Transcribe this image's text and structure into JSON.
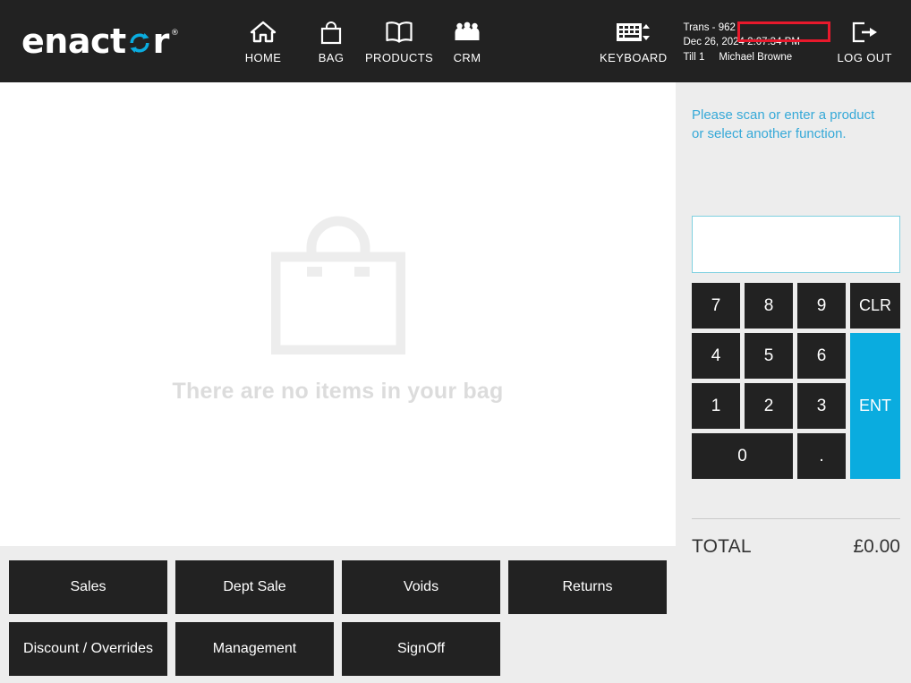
{
  "brand": {
    "name": "enactor",
    "trademark": "®",
    "accent_color": "#0aacdf"
  },
  "header": {
    "nav": [
      {
        "label": "HOME",
        "icon": "home-icon"
      },
      {
        "label": "BAG",
        "icon": "shopping-bag-icon"
      },
      {
        "label": "PRODUCTS",
        "icon": "book-icon"
      },
      {
        "label": "CRM",
        "icon": "people-icon"
      }
    ],
    "keyboard": {
      "label": "KEYBOARD",
      "icon": "keyboard-icon"
    },
    "transaction": {
      "trans": "Trans - 962",
      "datetime": "Dec 26, 2024 2:07:34 PM",
      "till": "Till 1",
      "user": "Michael Browne",
      "highlight_color": "#e8192c"
    },
    "logout": {
      "label": "LOG OUT",
      "icon": "logout-icon"
    }
  },
  "bag": {
    "icon": "shopping-bag-outline-icon",
    "empty_message": "There are no items in your bag"
  },
  "functions": [
    {
      "label": "Sales"
    },
    {
      "label": "Dept Sale"
    },
    {
      "label": "Voids"
    },
    {
      "label": "Returns"
    },
    {
      "label": "Discount / Overrides"
    },
    {
      "label": "Management"
    },
    {
      "label": "SignOff"
    }
  ],
  "right_panel": {
    "prompt_line1": "Please scan or enter a product",
    "prompt_line2": "or select another function.",
    "input_value": "",
    "input_placeholder": "",
    "keypad": [
      {
        "label": "7",
        "kind": "digit"
      },
      {
        "label": "8",
        "kind": "digit"
      },
      {
        "label": "9",
        "kind": "digit"
      },
      {
        "label": "CLR",
        "kind": "clear"
      },
      {
        "label": "4",
        "kind": "digit"
      },
      {
        "label": "5",
        "kind": "digit"
      },
      {
        "label": "6",
        "kind": "digit"
      },
      {
        "label": "1",
        "kind": "digit"
      },
      {
        "label": "2",
        "kind": "digit"
      },
      {
        "label": "3",
        "kind": "digit"
      },
      {
        "label": "0",
        "kind": "digit"
      },
      {
        "label": ".",
        "kind": "decimal"
      },
      {
        "label": "ENT",
        "kind": "enter"
      }
    ],
    "total_label": "TOTAL",
    "total_value": "£0.00"
  }
}
